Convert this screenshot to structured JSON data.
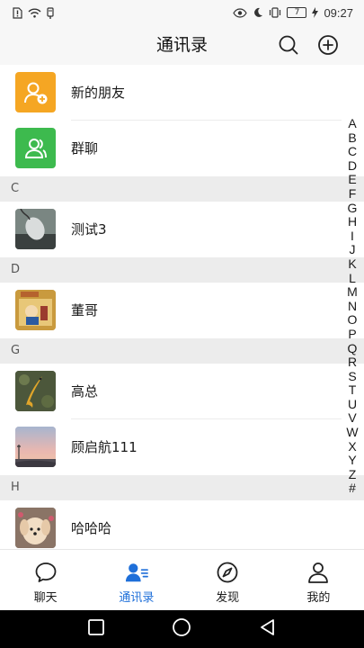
{
  "status_bar": {
    "battery_level": "7",
    "time": "09:27"
  },
  "header": {
    "title": "通讯录"
  },
  "fixed_items": [
    {
      "label": "新的朋友",
      "icon": "add-person-icon",
      "color": "#f5a623"
    },
    {
      "label": "群聊",
      "icon": "group-icon",
      "color": "#3dba4e"
    }
  ],
  "sections": [
    {
      "letter": "C",
      "contacts": [
        {
          "name": "测试3",
          "avatar": "computer-mouse-photo"
        }
      ]
    },
    {
      "letter": "D",
      "contacts": [
        {
          "name": "董哥",
          "avatar": "cartoon-photo"
        }
      ]
    },
    {
      "letter": "G",
      "contacts": [
        {
          "name": "高总",
          "avatar": "koi-fish-photo"
        },
        {
          "name": "顾启航111",
          "avatar": "sunset-photo"
        }
      ]
    },
    {
      "letter": "H",
      "contacts": [
        {
          "name": "哈哈哈",
          "avatar": "puppy-photo"
        }
      ]
    }
  ],
  "alphabet": [
    "A",
    "B",
    "C",
    "D",
    "E",
    "F",
    "G",
    "H",
    "I",
    "J",
    "K",
    "L",
    "M",
    "N",
    "O",
    "P",
    "Q",
    "R",
    "S",
    "T",
    "U",
    "V",
    "W",
    "X",
    "Y",
    "Z",
    "#"
  ],
  "tabs": [
    {
      "label": "聊天",
      "icon": "chat-bubble-icon",
      "active": false
    },
    {
      "label": "通讯录",
      "icon": "contacts-icon",
      "active": true
    },
    {
      "label": "发现",
      "icon": "compass-icon",
      "active": false
    },
    {
      "label": "我的",
      "icon": "person-icon",
      "active": false
    }
  ],
  "colors": {
    "accent": "#1e6fd9",
    "section_bg": "#ececec",
    "header_bg": "#f7f7f7"
  }
}
